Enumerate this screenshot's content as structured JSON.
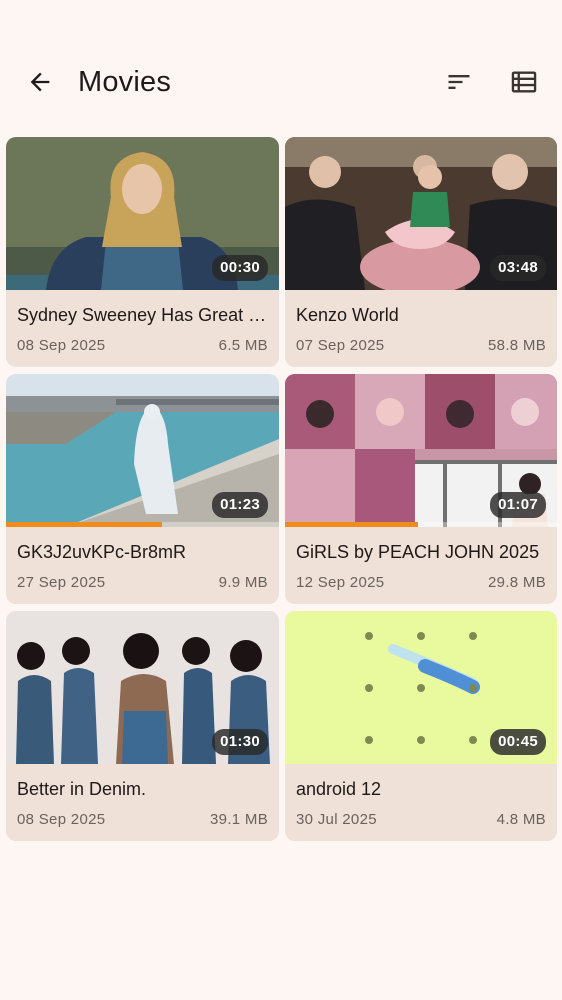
{
  "header": {
    "title": "Movies",
    "icons": {
      "back": "arrow-left-icon",
      "sort": "sort-icon",
      "view": "list-view-icon"
    }
  },
  "videos": [
    {
      "name": "Sydney Sweeney Has Great Jeans",
      "date": "08 Sep 2025",
      "size": "6.5 MB",
      "duration": "00:30",
      "progress": 0
    },
    {
      "name": "Kenzo World",
      "date": "07 Sep 2025",
      "size": "58.8 MB",
      "duration": "03:48",
      "progress": 0
    },
    {
      "name": "GK3J2uvKPc-Br8mR",
      "date": "27 Sep 2025",
      "size": "9.9 MB",
      "duration": "01:23",
      "progress": 0.57
    },
    {
      "name": "GiRLS by PEACH JOHN 2025",
      "date": "12 Sep 2025",
      "size": "29.8 MB",
      "duration": "01:07",
      "progress": 0.49
    },
    {
      "name": "Better in Denim.",
      "date": "08 Sep 2025",
      "size": "39.1 MB",
      "duration": "01:30",
      "progress": 0
    },
    {
      "name": "android 12",
      "date": "30 Jul 2025",
      "size": "4.8 MB",
      "duration": "00:45",
      "progress": 0
    }
  ],
  "colors": {
    "background": "#fdf6f2",
    "card": "#efe0d8",
    "progress": "#f08c1e"
  }
}
